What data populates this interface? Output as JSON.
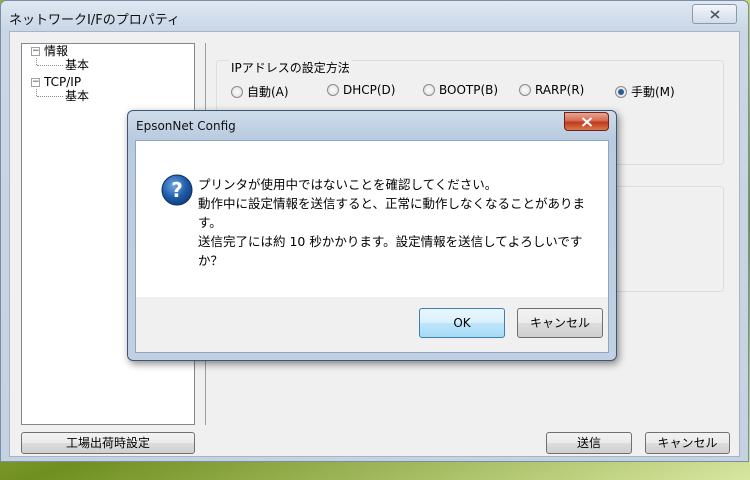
{
  "main_window": {
    "title": "ネットワークI/Fのプロパティ",
    "close_glyph": "✕",
    "tree": [
      {
        "label": "情報",
        "expander": "⊟"
      },
      {
        "label": "基本"
      },
      {
        "label": "TCP/IP",
        "expander": "⊟"
      },
      {
        "label": "基本"
      }
    ],
    "ip_method": {
      "group_title": "IPアドレスの設定方法",
      "options": [
        "自動(A)",
        "DHCP(D)",
        "BOOTP(B)",
        "RARP(R)",
        "手動(M)"
      ],
      "selected": "手動(M)"
    },
    "buttons": {
      "factory_reset": "工場出荷時設定",
      "send": "送信",
      "cancel": "キャンセル"
    }
  },
  "dialog": {
    "title": "EpsonNet Config",
    "icon": "question-icon",
    "message_lines": [
      "プリンタが使用中ではないことを確認してください。",
      "動作中に設定情報を送信すると、正常に動作しなくなることがありま",
      "す。",
      "送信完了には約 10 秒かかります。設定情報を送信してよろしいです",
      "か？"
    ],
    "ok_label": "OK",
    "cancel_label": "キャンセル"
  },
  "colors": {
    "dialog_close_red": "#c2391b",
    "question_icon_blue": "#1e5aa8",
    "radio_selected": "#2d5b98"
  }
}
